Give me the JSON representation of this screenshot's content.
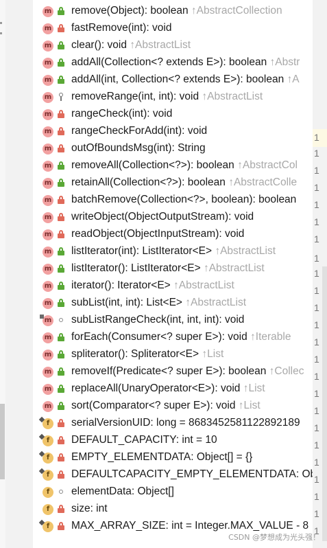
{
  "members": [
    {
      "kind": "m",
      "overlay": "",
      "vis": "pub",
      "sig": "remove(Object): boolean",
      "from": "↑AbstractCollection"
    },
    {
      "kind": "m",
      "overlay": "",
      "vis": "priv",
      "sig": "fastRemove(int): void",
      "from": ""
    },
    {
      "kind": "m",
      "overlay": "",
      "vis": "pub",
      "sig": "clear(): void",
      "from": "↑AbstractList"
    },
    {
      "kind": "m",
      "overlay": "",
      "vis": "pub",
      "sig": "addAll(Collection<? extends E>): boolean",
      "from": "↑Abstr"
    },
    {
      "kind": "m",
      "overlay": "",
      "vis": "pub",
      "sig": "addAll(int, Collection<? extends E>): boolean",
      "from": "↑A"
    },
    {
      "kind": "m",
      "overlay": "",
      "vis": "prot",
      "sig": "removeRange(int, int): void",
      "from": "↑AbstractList"
    },
    {
      "kind": "m",
      "overlay": "",
      "vis": "priv",
      "sig": "rangeCheck(int): void",
      "from": ""
    },
    {
      "kind": "m",
      "overlay": "",
      "vis": "priv",
      "sig": "rangeCheckForAdd(int): void",
      "from": ""
    },
    {
      "kind": "m",
      "overlay": "",
      "vis": "priv",
      "sig": "outOfBoundsMsg(int): String",
      "from": ""
    },
    {
      "kind": "m",
      "overlay": "",
      "vis": "pub",
      "sig": "removeAll(Collection<?>): boolean",
      "from": "↑AbstractCol"
    },
    {
      "kind": "m",
      "overlay": "",
      "vis": "pub",
      "sig": "retainAll(Collection<?>): boolean",
      "from": "↑AbstractColle"
    },
    {
      "kind": "m",
      "overlay": "",
      "vis": "priv",
      "sig": "batchRemove(Collection<?>, boolean): boolean",
      "from": ""
    },
    {
      "kind": "m",
      "overlay": "",
      "vis": "priv",
      "sig": "writeObject(ObjectOutputStream): void",
      "from": ""
    },
    {
      "kind": "m",
      "overlay": "",
      "vis": "priv",
      "sig": "readObject(ObjectInputStream): void",
      "from": ""
    },
    {
      "kind": "m",
      "overlay": "",
      "vis": "pub",
      "sig": "listIterator(int): ListIterator<E>",
      "from": "↑AbstractList"
    },
    {
      "kind": "m",
      "overlay": "",
      "vis": "pub",
      "sig": "listIterator(): ListIterator<E>",
      "from": "↑AbstractList"
    },
    {
      "kind": "m",
      "overlay": "",
      "vis": "pub",
      "sig": "iterator(): Iterator<E>",
      "from": "↑AbstractList"
    },
    {
      "kind": "m",
      "overlay": "",
      "vis": "pub",
      "sig": "subList(int, int): List<E>",
      "from": "↑AbstractList"
    },
    {
      "kind": "m",
      "overlay": "stat",
      "vis": "pkg",
      "sig": "subListRangeCheck(int, int, int): void",
      "from": ""
    },
    {
      "kind": "m",
      "overlay": "",
      "vis": "pub",
      "sig": "forEach(Consumer<? super E>): void",
      "from": "↑Iterable"
    },
    {
      "kind": "m",
      "overlay": "",
      "vis": "pub",
      "sig": "spliterator(): Spliterator<E>",
      "from": "↑List"
    },
    {
      "kind": "m",
      "overlay": "",
      "vis": "pub",
      "sig": "removeIf(Predicate<? super E>): boolean",
      "from": "↑Collec"
    },
    {
      "kind": "m",
      "overlay": "",
      "vis": "pub",
      "sig": "replaceAll(UnaryOperator<E>): void",
      "from": "↑List"
    },
    {
      "kind": "m",
      "overlay": "",
      "vis": "pub",
      "sig": "sort(Comparator<? super E>): void",
      "from": "↑List"
    },
    {
      "kind": "f",
      "overlay": "pin",
      "vis": "priv",
      "sig": "serialVersionUID: long = 8683452581122892189",
      "from": ""
    },
    {
      "kind": "f",
      "overlay": "pin",
      "vis": "priv",
      "sig": "DEFAULT_CAPACITY: int = 10",
      "from": ""
    },
    {
      "kind": "f",
      "overlay": "pin",
      "vis": "priv",
      "sig": "EMPTY_ELEMENTDATA: Object[] = {}",
      "from": ""
    },
    {
      "kind": "f",
      "overlay": "pin",
      "vis": "priv",
      "sig": "DEFAULTCAPACITY_EMPTY_ELEMENTDATA: Obje",
      "from": ""
    },
    {
      "kind": "f",
      "overlay": "",
      "vis": "pkg",
      "sig": "elementData: Object[]",
      "from": ""
    },
    {
      "kind": "f",
      "overlay": "",
      "vis": "priv",
      "sig": "size: int",
      "from": ""
    },
    {
      "kind": "f",
      "overlay": "pin",
      "vis": "priv",
      "sig": "MAX_ARRAY_SIZE: int = Integer.MAX_VALUE - 8",
      "from": ""
    }
  ],
  "gutter_text": "1",
  "watermark": "CSDN @梦想成为光头强！"
}
